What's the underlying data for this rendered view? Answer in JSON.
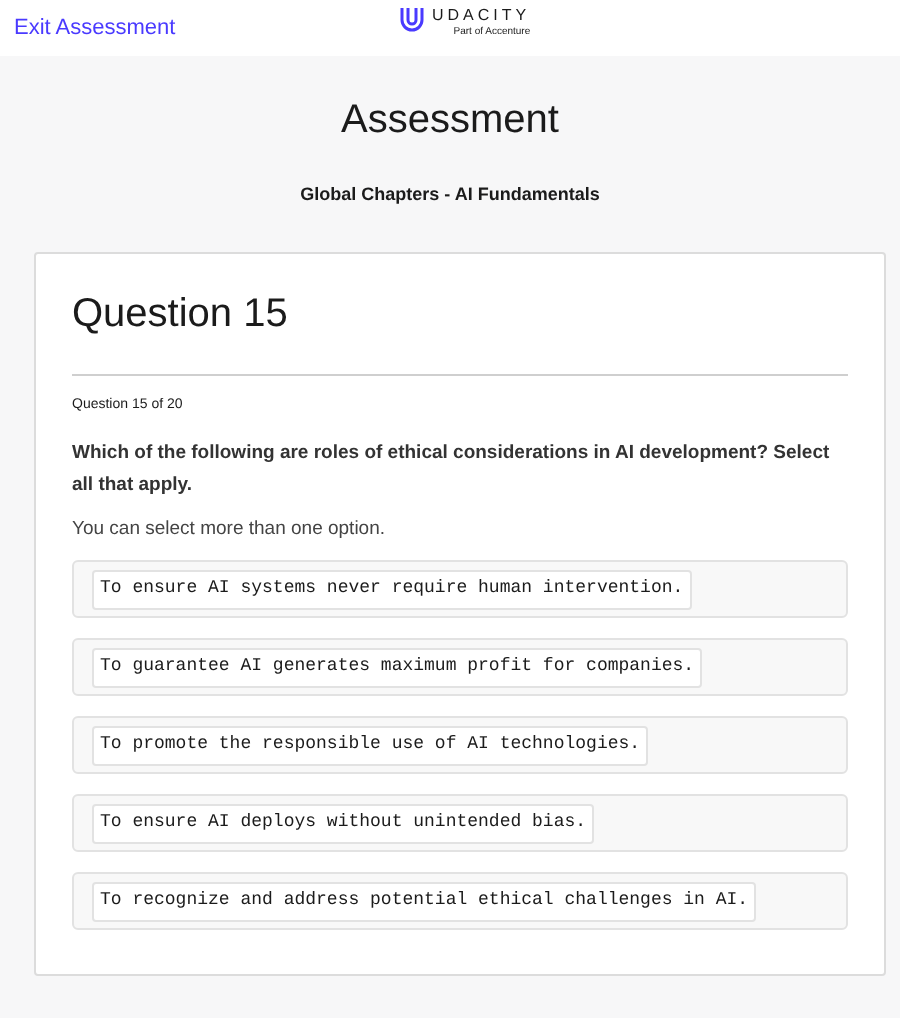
{
  "header": {
    "exit_link": "Exit Assessment",
    "logo": {
      "wordmark": "UDACITY",
      "tagline": "Part of Accenture"
    }
  },
  "page": {
    "title": "Assessment",
    "subtitle": "Global Chapters - AI Fundamentals"
  },
  "question": {
    "heading": "Question 15",
    "progress": "Question 15 of 20",
    "prompt": "Which of the following are roles of ethical considerations in AI development? Select all that apply.",
    "hint": "You can select more than one option.",
    "options": [
      {
        "text": "To ensure AI systems never require human intervention."
      },
      {
        "text": "To guarantee AI generates maximum profit for companies."
      },
      {
        "text": "To promote the responsible use of AI technologies."
      },
      {
        "text": "To ensure AI deploys without unintended bias."
      },
      {
        "text": "To recognize and address potential ethical challenges in AI."
      }
    ]
  }
}
